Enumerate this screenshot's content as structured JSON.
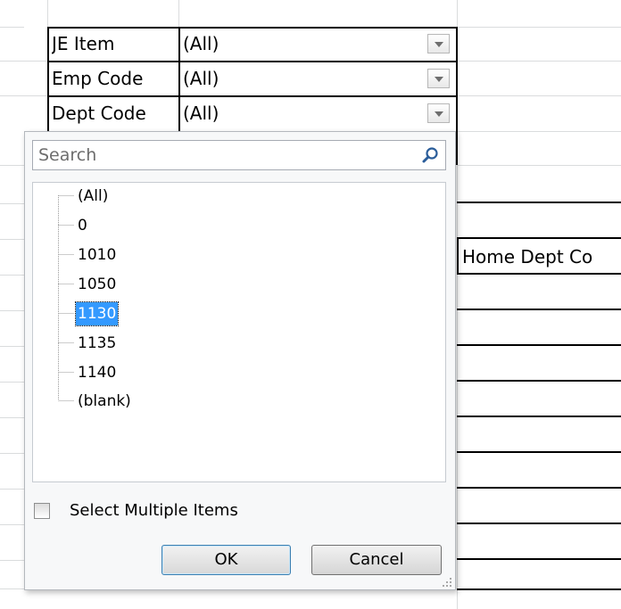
{
  "pivot_filters": [
    {
      "field": "JE Item",
      "value": "(All)"
    },
    {
      "field": "Emp Code",
      "value": "(All)"
    },
    {
      "field": "Dept Code",
      "value": "(All)"
    }
  ],
  "table_header": "Home Dept Co",
  "filter_popup": {
    "search_placeholder": "Search",
    "items": [
      "(All)",
      "0",
      "1010",
      "1050",
      "1130",
      "1135",
      "1140",
      "(blank)"
    ],
    "selected_item": "1130",
    "select_multiple_label": "Select Multiple Items",
    "select_multiple_checked": false,
    "ok_label": "OK",
    "cancel_label": "Cancel"
  },
  "icons": {
    "search": "magnifier-icon",
    "dropdown": "chevron-down-icon",
    "resize": "resize-grip-icon"
  }
}
